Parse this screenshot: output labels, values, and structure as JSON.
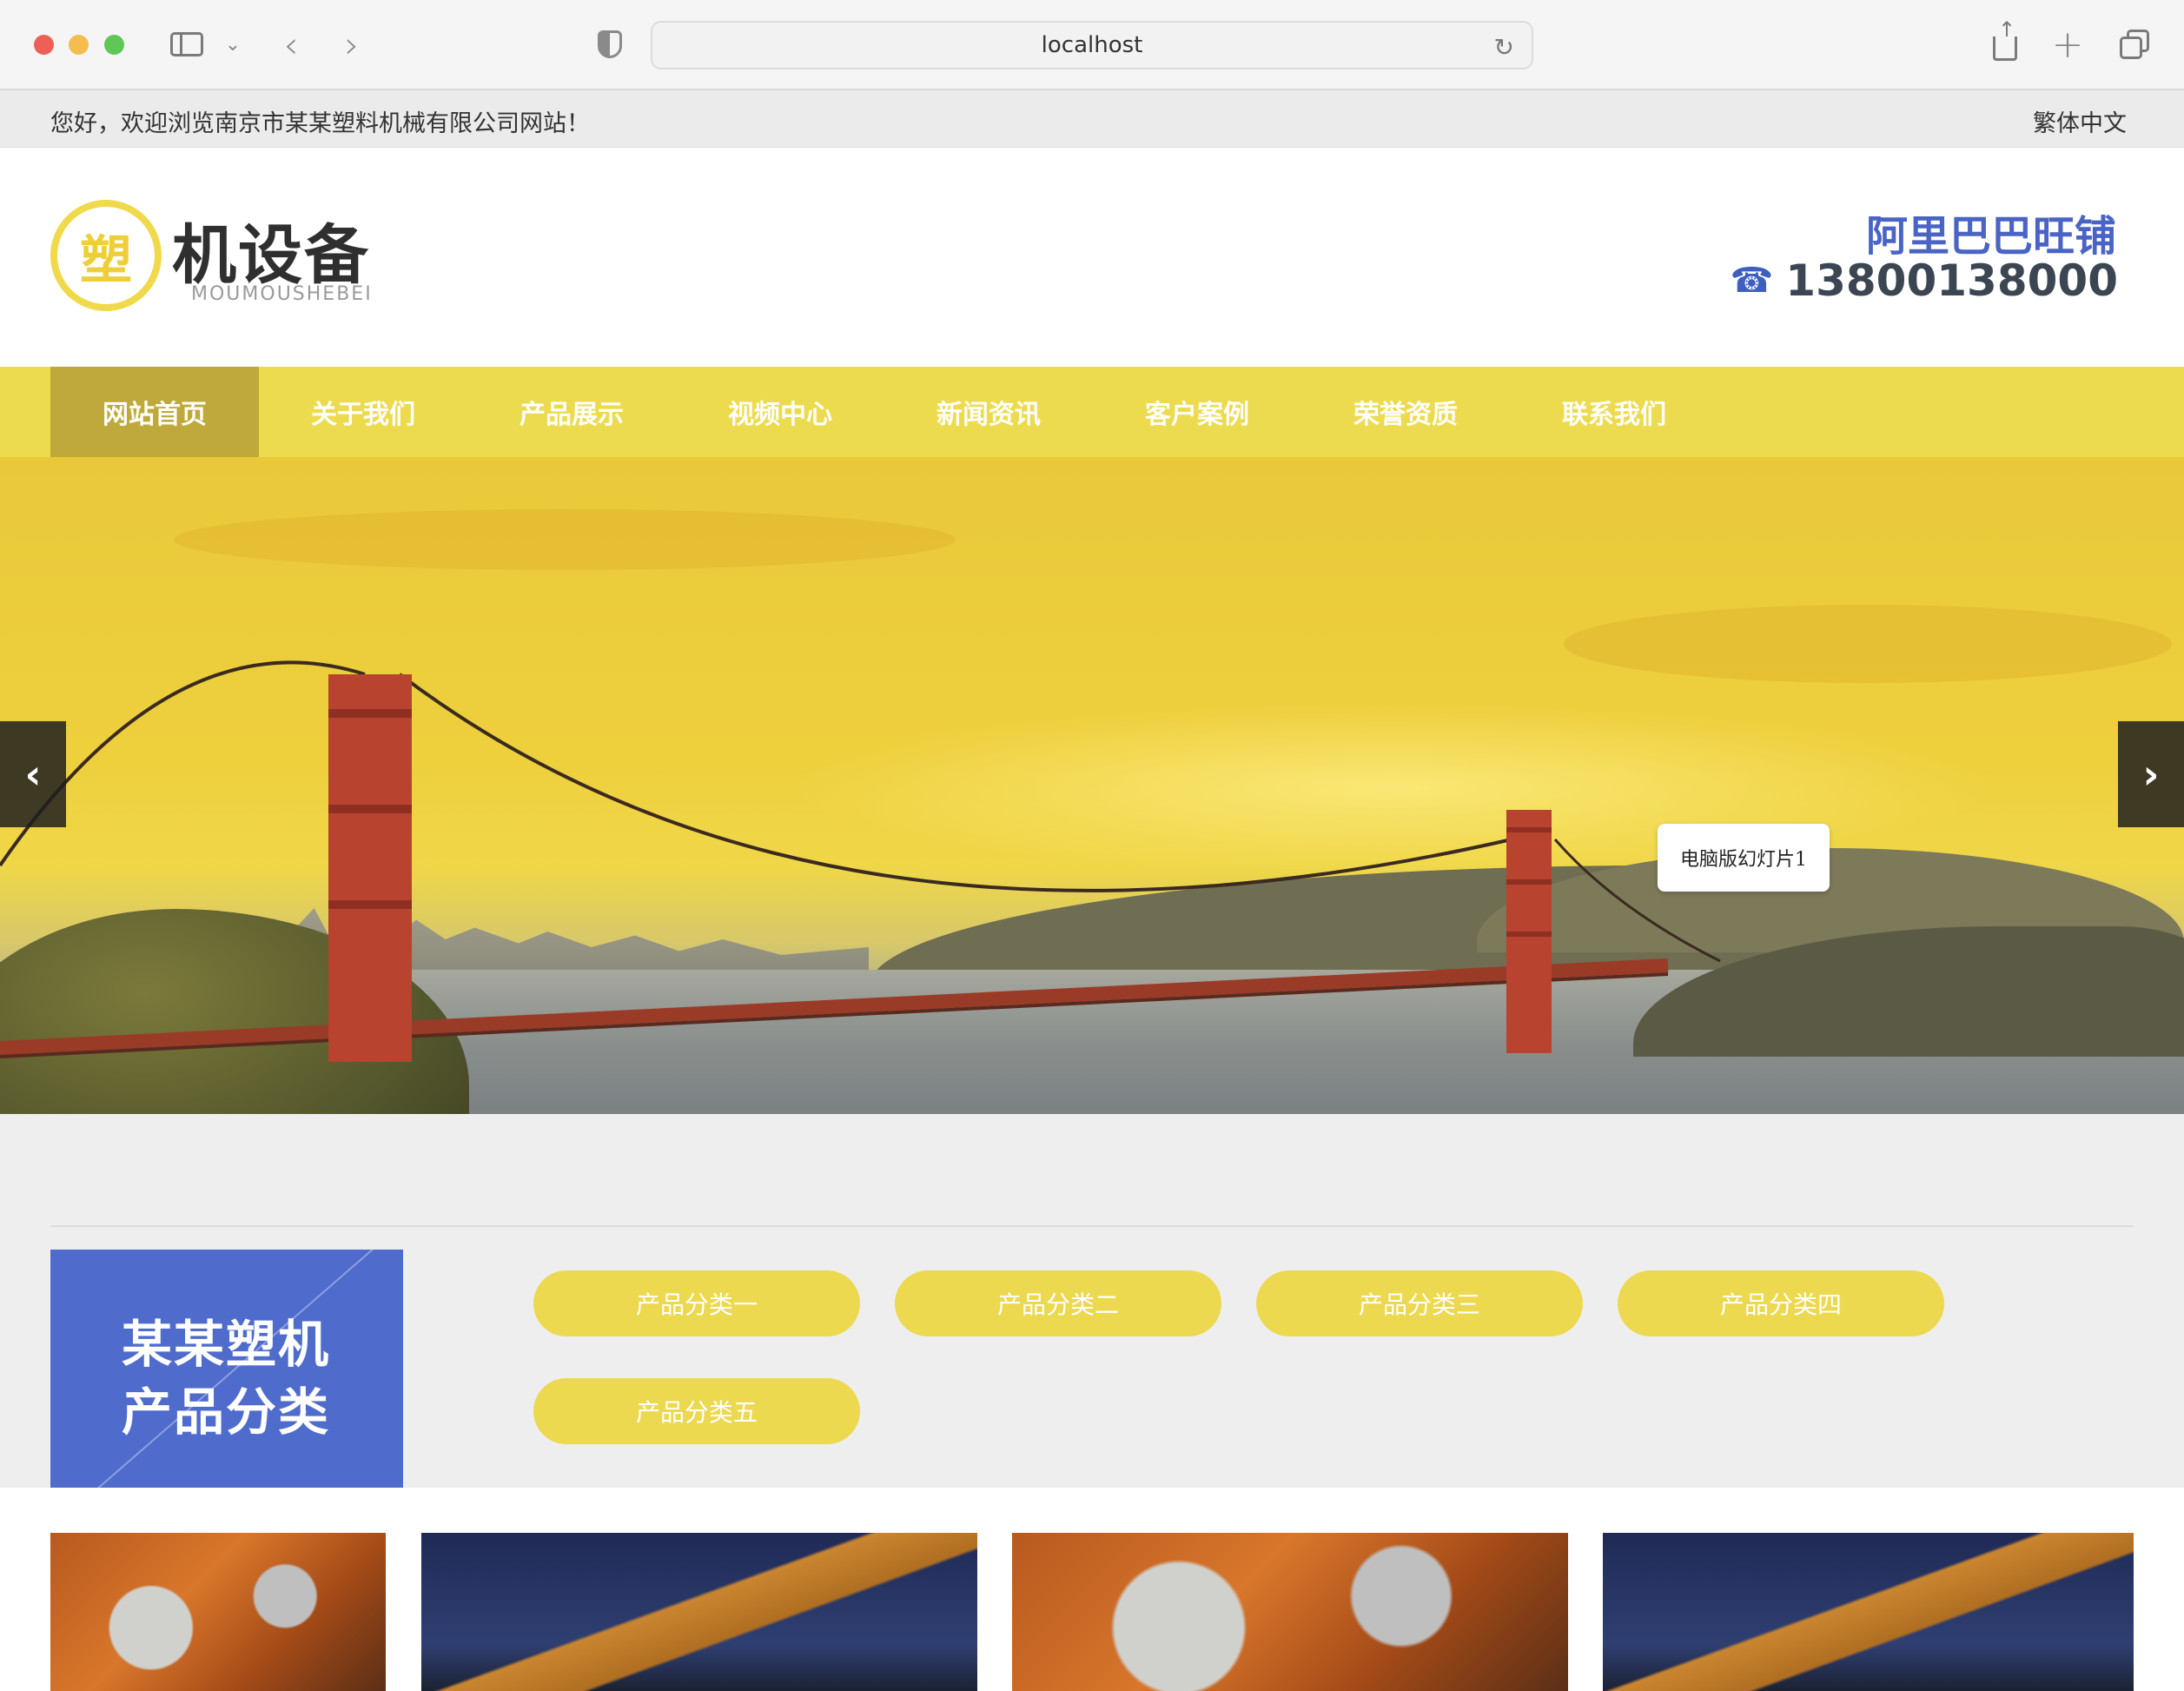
{
  "browser": {
    "url": "localhost",
    "colors": {
      "close": "#ee5f56",
      "minimize": "#f4bd4f",
      "zoom": "#60c656"
    }
  },
  "topbar": {
    "welcome": "您好，欢迎浏览南京市某某塑料机械有限公司网站！",
    "language": "繁体中文"
  },
  "header": {
    "logo_mark": "塑",
    "logo_text": "机设备",
    "logo_sub": "MOUMOUSHEBEI",
    "shop_label": "阿里巴巴旺铺",
    "phone_icon": "☎",
    "phone": "13800138000"
  },
  "nav": {
    "items": [
      "网站首页",
      "关于我们",
      "产品展示",
      "视频中心",
      "新闻资讯",
      "客户案例",
      "荣誉资质",
      "联系我们"
    ],
    "active_index": 0,
    "colors": {
      "bar": "#ecdb4f",
      "active": "#bfa93a"
    }
  },
  "banner": {
    "caption": "电脑版幻灯片1",
    "prev_icon": "‹",
    "next_icon": "›"
  },
  "categories": {
    "title_line1": "某某塑机",
    "title_line2": "产品分类",
    "items": [
      "产品分类一",
      "产品分类二",
      "产品分类三",
      "产品分类四",
      "产品分类五"
    ],
    "colors": {
      "box": "#4f6ccd",
      "button": "#ecd94f"
    }
  },
  "products": {
    "images": [
      "engine-photo",
      "excavator-photo",
      "engine-photo",
      "excavator-photo"
    ]
  }
}
